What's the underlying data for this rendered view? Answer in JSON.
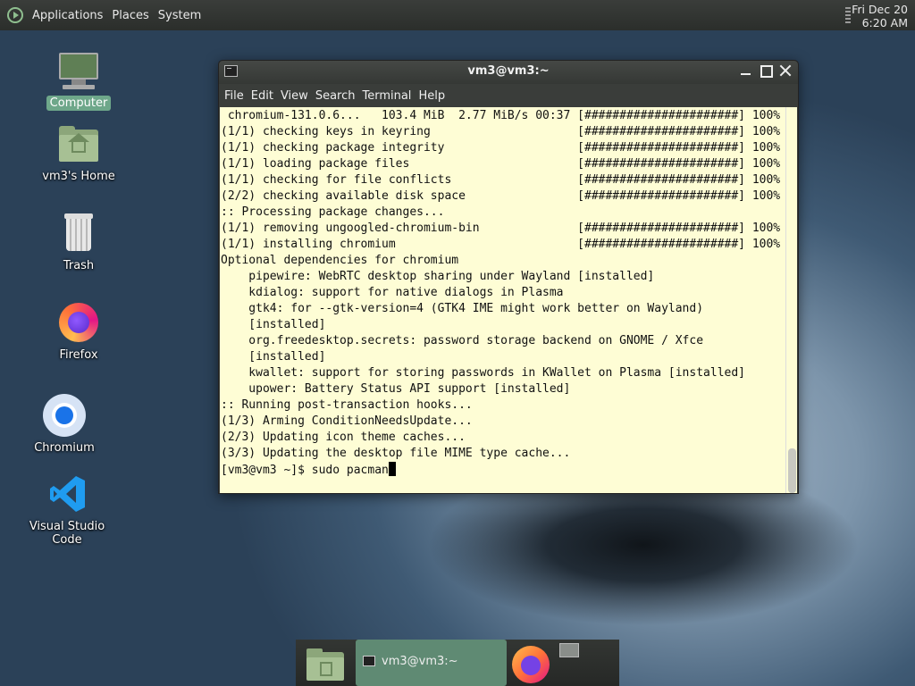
{
  "top_panel": {
    "menus": [
      "Applications",
      "Places",
      "System"
    ],
    "clock": {
      "date": "Fri Dec 20",
      "time": "6:20 AM"
    }
  },
  "desktop_icons": [
    {
      "label": "Computer",
      "icon": "computer-icon"
    },
    {
      "label": "vm3's Home",
      "icon": "home-folder-icon"
    },
    {
      "label": "Trash",
      "icon": "trash-icon"
    },
    {
      "label": "Firefox",
      "icon": "firefox-icon"
    },
    {
      "label": "Chromium",
      "icon": "chromium-icon"
    },
    {
      "label": "Visual Studio Code",
      "icon": "vscode-icon"
    }
  ],
  "terminal": {
    "title": "vm3@vm3:~",
    "menus": [
      "File",
      "Edit",
      "View",
      "Search",
      "Terminal",
      "Help"
    ],
    "lines": [
      " chromium-131.0.6...   103.4 MiB  2.77 MiB/s 00:37 [######################] 100%",
      "(1/1) checking keys in keyring                     [######################] 100%",
      "(1/1) checking package integrity                   [######################] 100%",
      "(1/1) loading package files                        [######################] 100%",
      "(1/1) checking for file conflicts                  [######################] 100%",
      "(2/2) checking available disk space                [######################] 100%",
      ":: Processing package changes...",
      "(1/1) removing ungoogled-chromium-bin              [######################] 100%",
      "(1/1) installing chromium                          [######################] 100%",
      "Optional dependencies for chromium",
      "    pipewire: WebRTC desktop sharing under Wayland [installed]",
      "    kdialog: support for native dialogs in Plasma",
      "    gtk4: for --gtk-version=4 (GTK4 IME might work better on Wayland)",
      "    [installed]",
      "    org.freedesktop.secrets: password storage backend on GNOME / Xfce",
      "    [installed]",
      "    kwallet: support for storing passwords in KWallet on Plasma [installed]",
      "    upower: Battery Status API support [installed]",
      ":: Running post-transaction hooks...",
      "(1/3) Arming ConditionNeedsUpdate...",
      "(2/3) Updating icon theme caches...",
      "(3/3) Updating the desktop file MIME type cache..."
    ],
    "prompt": "[vm3@vm3 ~]$ ",
    "input": "sudo pacman"
  },
  "taskbar": {
    "items": [
      {
        "icon": "files-icon"
      },
      {
        "icon": "terminal-icon",
        "label": "vm3@vm3:~"
      },
      {
        "icon": "firefox-icon"
      },
      {
        "icon": "workspace-icon"
      }
    ]
  }
}
